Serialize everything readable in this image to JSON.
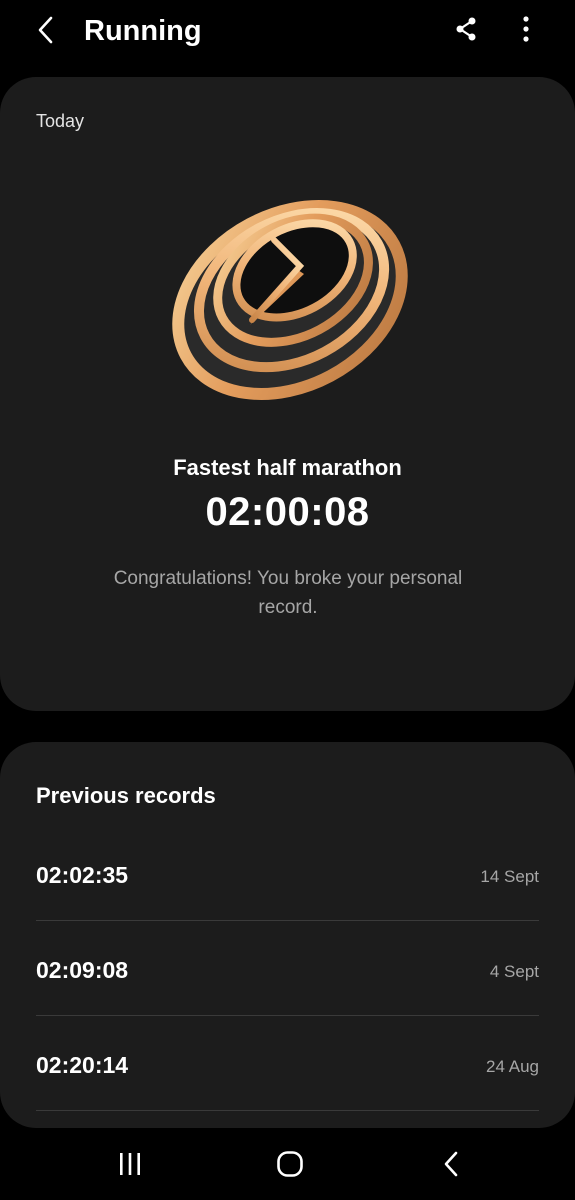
{
  "app_bar": {
    "title": "Running",
    "icons": [
      "back-arrow-icon",
      "share-icon",
      "more-vert-icon"
    ]
  },
  "today_card": {
    "date_label": "Today",
    "medal_icon": "clock-medal-icon",
    "record_title": "Fastest half marathon",
    "record_time": "02:00:08",
    "message": "Congratulations! You broke your personal record."
  },
  "previous_records": {
    "title": "Previous records",
    "items": [
      {
        "time": "02:02:35",
        "date": "14 Sept"
      },
      {
        "time": "02:09:08",
        "date": "4 Sept"
      },
      {
        "time": "02:20:14",
        "date": "24 Aug"
      }
    ]
  },
  "nav_bar": {
    "icons": [
      "recents-icon",
      "home-icon",
      "back-icon"
    ]
  },
  "colors": {
    "background": "#000000",
    "card": "#1c1c1c",
    "secondary_text": "#a6a6a6",
    "medal_gold": "#e8a96a"
  }
}
